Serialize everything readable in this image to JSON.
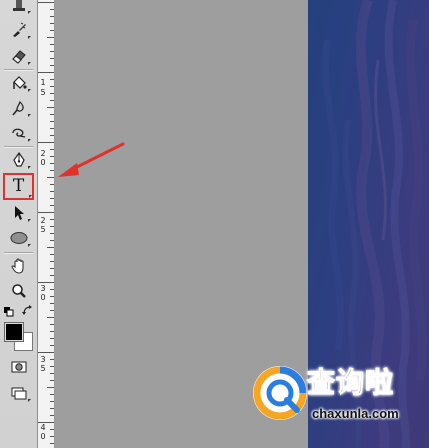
{
  "toolbar": {
    "tools": [
      {
        "name": "stamp-tool",
        "icon": "stamp-icon"
      },
      {
        "name": "history-brush-tool",
        "icon": "history-brush-icon"
      },
      {
        "name": "eraser-tool",
        "icon": "eraser-icon"
      },
      {
        "name": "paint-bucket-tool",
        "icon": "paint-bucket-icon"
      },
      {
        "name": "blur-tool",
        "icon": "blur-drop-icon"
      },
      {
        "name": "dodge-tool",
        "icon": "dodge-icon"
      },
      {
        "name": "pen-tool",
        "icon": "pen-icon"
      },
      {
        "name": "type-tool",
        "icon": "type-icon",
        "glyph": "T",
        "highlighted": true,
        "highlight_color": "#e0312b"
      },
      {
        "name": "path-selection-tool",
        "icon": "path-selection-icon"
      },
      {
        "name": "ellipse-tool",
        "icon": "ellipse-icon"
      },
      {
        "name": "hand-tool",
        "icon": "hand-icon"
      },
      {
        "name": "zoom-tool",
        "icon": "zoom-icon"
      }
    ],
    "colors": {
      "foreground": "#000000",
      "background": "#ffffff"
    }
  },
  "ruler": {
    "labels": [
      "1",
      "5",
      "2",
      "0",
      "2",
      "5",
      "3",
      "0",
      "3",
      "5",
      "4",
      "0"
    ]
  },
  "annotation": {
    "arrow_color": "#e0312b"
  },
  "watermark": {
    "title": "查询啦",
    "url": "chaxunla.com",
    "logo_colors": [
      "#f5a623",
      "#2a7de1"
    ]
  },
  "colors": {
    "pasteboard": "#9e9e9e",
    "toolbar": "#d4d4d4",
    "canvas": "#2c3f80"
  }
}
